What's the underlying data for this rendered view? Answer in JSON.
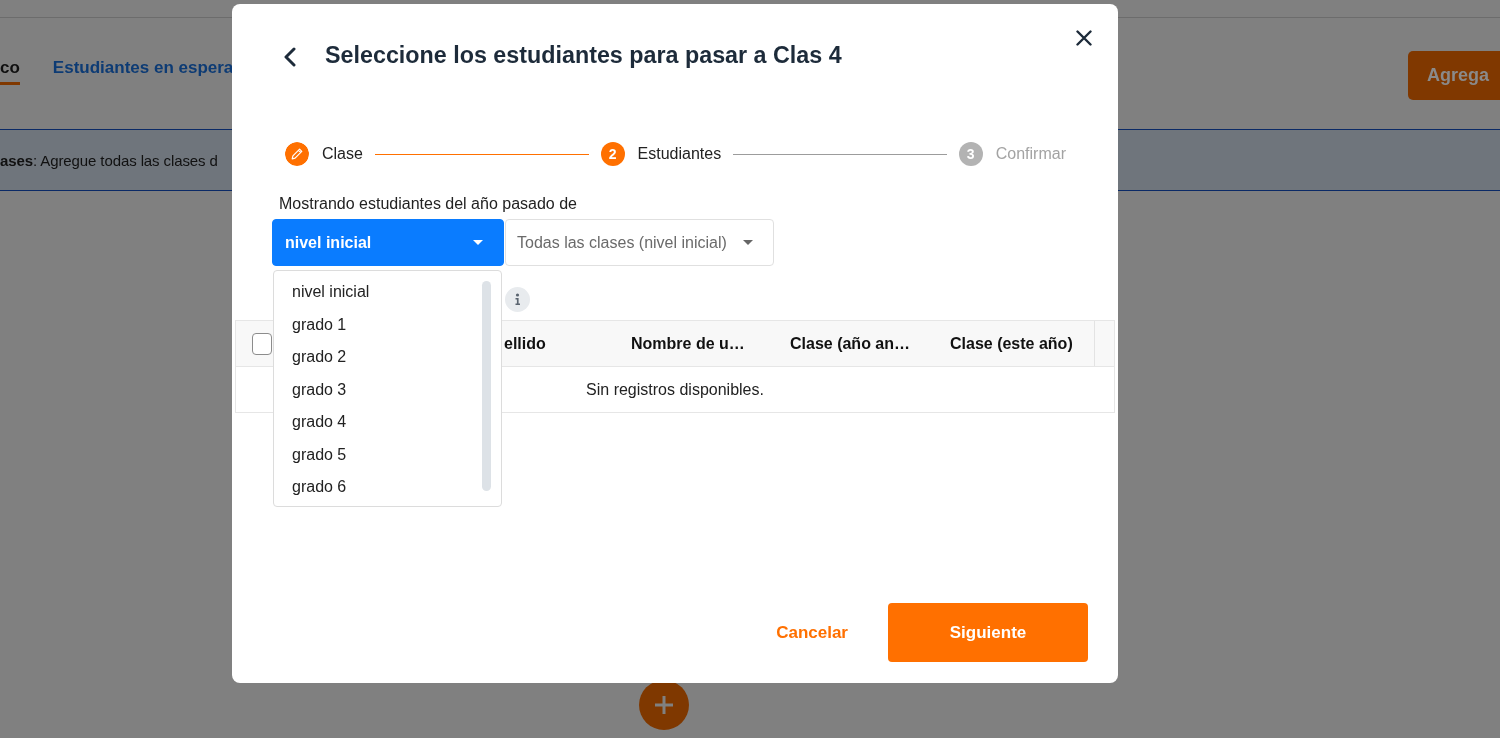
{
  "background_page": {
    "tabs": [
      {
        "label": "co",
        "selected": true
      },
      {
        "label": "Estudiantes en espera",
        "selected": false
      }
    ],
    "add_button": {
      "label": "Agrega"
    },
    "banner": {
      "text": "**ases**: Agregue todas las clases d"
    }
  },
  "dialog": {
    "title": "Seleccione los estudiantes para pasar a Clas 4",
    "steps": [
      {
        "label": "Clase",
        "kind": "done"
      },
      {
        "number": "2",
        "label": "Estudiantes",
        "kind": "current"
      },
      {
        "number": "3",
        "label": "Confirmar",
        "kind": "upcoming"
      }
    ],
    "filter_label": "Mostrando estudiantes del año pasado de",
    "filters": [
      {
        "value": "nivel inicial",
        "open": true,
        "options": [
          "nivel inicial",
          "grado 1",
          "grado 2",
          "grado 3",
          "grado 4",
          "grado 5",
          "grado 6"
        ]
      },
      {
        "value": "Todas las clases (nivel inicial)",
        "open": false
      }
    ],
    "table": {
      "select_all_checked": false,
      "columns": [
        "ellido",
        "Nombre de u…",
        "Clase (año an…",
        "Clase (este año)"
      ],
      "empty_message": "Sin registros disponibles."
    },
    "buttons": [
      {
        "label": "Cancelar",
        "kind": "text"
      },
      {
        "label": "Siguiente",
        "kind": "primary"
      }
    ]
  }
}
